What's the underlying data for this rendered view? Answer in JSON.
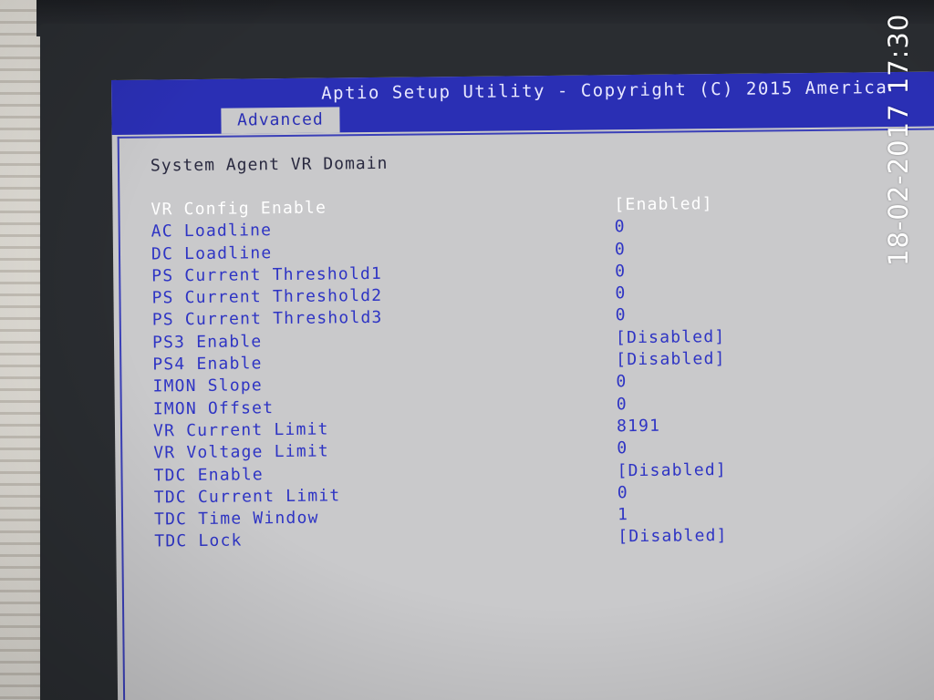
{
  "window": {
    "title": "Aptio Setup Utility - Copyright (C) 2015 America"
  },
  "tabs": [
    {
      "label": "Advanced",
      "active": true
    }
  ],
  "section": {
    "title": "System Agent VR Domain"
  },
  "settings": [
    {
      "label": "VR Config Enable",
      "value": "[Enabled]",
      "selected": true
    },
    {
      "label": "AC Loadline",
      "value": "0"
    },
    {
      "label": "DC Loadline",
      "value": "0"
    },
    {
      "label": "PS Current Threshold1",
      "value": "0"
    },
    {
      "label": "PS Current Threshold2",
      "value": "0"
    },
    {
      "label": "PS Current Threshold3",
      "value": "0"
    },
    {
      "label": "PS3 Enable",
      "value": "[Disabled]"
    },
    {
      "label": "PS4 Enable",
      "value": "[Disabled]"
    },
    {
      "label": "IMON Slope",
      "value": "0"
    },
    {
      "label": "IMON Offset",
      "value": "0"
    },
    {
      "label": "VR Current Limit",
      "value": "8191"
    },
    {
      "label": "VR Voltage Limit",
      "value": "0"
    },
    {
      "label": "TDC Enable",
      "value": "[Disabled]"
    },
    {
      "label": "TDC Current Limit",
      "value": "0"
    },
    {
      "label": "TDC Time Window",
      "value": "1"
    },
    {
      "label": "TDC Lock",
      "value": "[Disabled]"
    }
  ],
  "photo": {
    "timestamp": "18-02-2017 17:30"
  },
  "colors": {
    "bios_blue": "#2a2fb4",
    "bios_grey": "#c9c9cb",
    "item_text": "#2e34c4",
    "selected_text": "#ffffff"
  }
}
